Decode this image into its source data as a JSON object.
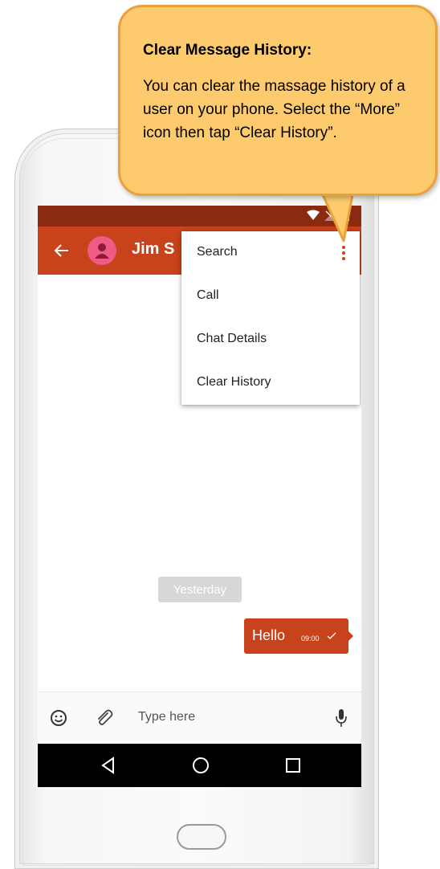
{
  "callout": {
    "title": "Clear Message History:",
    "body": "You can clear the massage history of a user on your phone. Select the “More” icon then tap “Clear History”."
  },
  "app_bar": {
    "back_icon": "arrow-back-icon",
    "contact_name": "Jim S",
    "more_icon": "more-vert-icon"
  },
  "menu": {
    "items": [
      {
        "label": "Search"
      },
      {
        "label": "Call"
      },
      {
        "label": "Chat Details"
      },
      {
        "label": "Clear History"
      }
    ]
  },
  "chat": {
    "date_chip": "Yesterday",
    "message": {
      "text": "Hello",
      "time": "09:00",
      "status_icon": "check-icon"
    }
  },
  "input_bar": {
    "placeholder": "Type here",
    "emoji_icon": "emoji-icon",
    "attach_icon": "paperclip-icon",
    "mic_icon": "mic-icon"
  },
  "nav_bar": {
    "back_icon": "nav-back-triangle-icon",
    "home_icon": "nav-home-circle-icon",
    "recents_icon": "nav-recents-square-icon"
  },
  "colors": {
    "accent": "#c8421b",
    "status_bar": "#8a2a10",
    "avatar": "#ef5b84",
    "callout_fill": "#fdcb6e",
    "callout_border": "#e9a23b"
  }
}
